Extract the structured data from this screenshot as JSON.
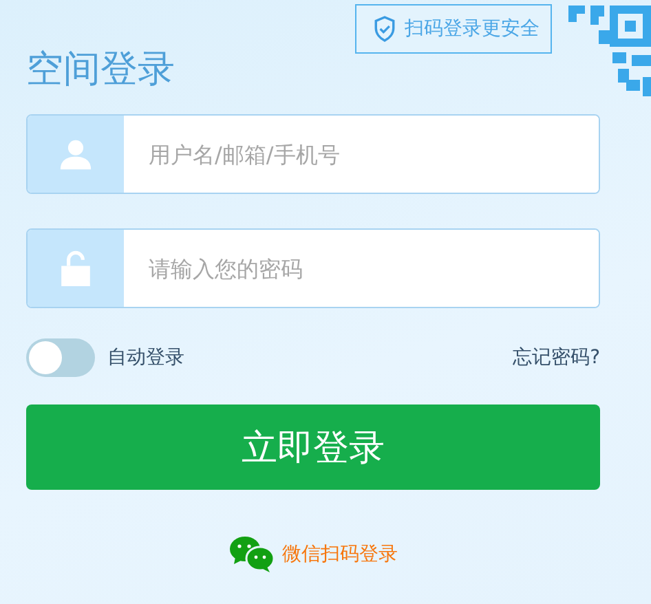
{
  "title": "空间登录",
  "qr_hint": {
    "label": "扫码登录更安全"
  },
  "fields": [
    {
      "kind": "user",
      "placeholder": "用户名/邮箱/手机号"
    },
    {
      "kind": "password",
      "placeholder": "请输入您的密码"
    }
  ],
  "auto_login": {
    "label": "自动登录",
    "on": false
  },
  "forgot_link": "忘记密码?",
  "login_button": "立即登录",
  "wechat_link": "微信扫码登录"
}
